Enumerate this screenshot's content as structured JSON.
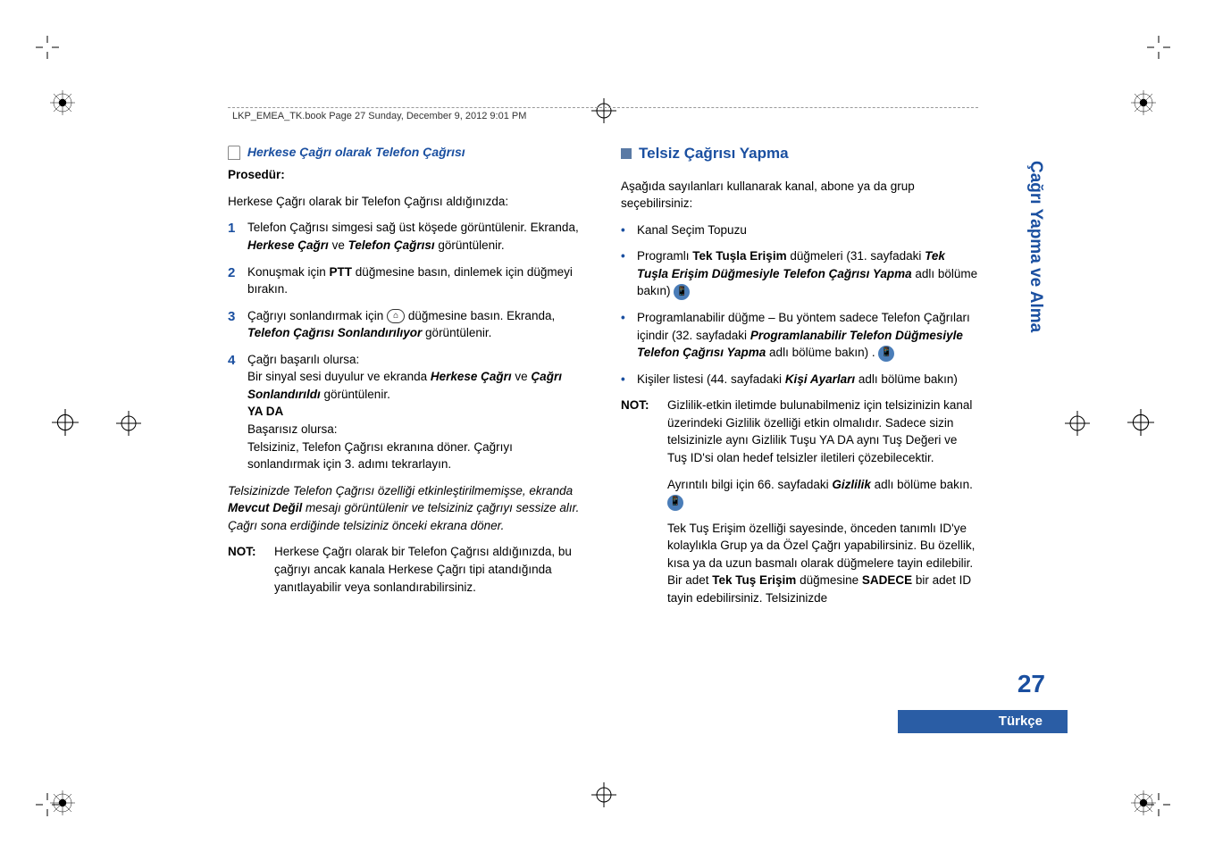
{
  "header": "LKP_EMEA_TK.book  Page 27  Sunday, December 9, 2012  9:01 PM",
  "left": {
    "title": "Herkese Çağrı olarak Telefon Çağrısı",
    "proc_label": "Prosedür:",
    "proc_intro": "Herkese Çağrı olarak bir Telefon Çağrısı aldığınızda:",
    "s1a": "Telefon Çağrısı simgesi sağ üst köşede görüntülenir. Ekranda, ",
    "s1b": "Herkese Çağrı",
    "s1c": " ve ",
    "s1d": "Telefon Çağrısı",
    "s1e": " görüntülenir.",
    "s2a": "Konuşmak için ",
    "s2b": "PTT",
    "s2c": " düğmesine basın, dinlemek için düğmeyi bırakın.",
    "s3a": "Çağrıyı sonlandırmak için ",
    "s3b": " düğmesine basın. Ekranda, ",
    "s3c": "Telefon Çağrısı Sonlandırılıyor",
    "s3d": " görüntülenir.",
    "s4a": "Çağrı başarılı olursa:",
    "s4b": "Bir sinyal sesi duyulur ve ekranda ",
    "s4c": "Herkese Çağrı",
    "s4d": " ve ",
    "s4e": "Çağrı Sonlandırıldı",
    "s4f": " görüntülenir.",
    "s4g": "YA DA",
    "s4h": "Başarısız olursa:",
    "s4i": "Telsiziniz, Telefon Çağrısı ekranına döner. Çağrıyı sonlandırmak için 3. adımı tekrarlayın.",
    "ital1": "Telsizinizde Telefon Çağrısı özelliği etkinleştirilmemişse, ekranda ",
    "ital2": "Mevcut Değil",
    "ital3": " mesajı görüntülenir ve telsiziniz çağrıyı sessize alır. Çağrı sona erdiğinde telsiziniz önceki ekrana döner.",
    "note_label": "NOT:",
    "note_text": "Herkese Çağrı olarak bir Telefon Çağrısı aldığınızda, bu çağrıyı ancak kanala Herkese Çağrı tipi atandığında yanıtlayabilir veya sonlandırabilirsiniz."
  },
  "right": {
    "heading": "Telsiz Çağrısı Yapma",
    "intro": "Aşağıda sayılanları kullanarak kanal, abone ya da grup seçebilirsiniz:",
    "b1": "Kanal Seçim Topuzu",
    "b2a": "Programlı ",
    "b2b": "Tek Tuşla Erişim",
    "b2c": " düğmeleri  (31. sayfadaki ",
    "b2d": "Tek Tuşla Erişim Düğmesiyle Telefon Çağrısı Yapma",
    "b2e": " adlı bölüme bakın) ",
    "b3a": "Programlanabilir düğme – Bu yöntem sadece Telefon Çağrıları içindir (32. sayfadaki ",
    "b3b": "Programlanabilir Telefon Düğmesiyle Telefon Çağrısı Yapma",
    "b3c": " adlı bölüme bakın) . ",
    "b4a": "Kişiler listesi (44. sayfadaki ",
    "b4b": "Kişi Ayarları",
    "b4c": " adlı bölüme bakın)",
    "note_label": "NOT:",
    "n1": "Gizlilik-etkin iletimde bulunabilmeniz için telsizinizin kanal üzerindeki Gizlilik özelliği etkin olmalıdır. Sadece sizin telsizinizle aynı Gizlilik Tuşu YA DA aynı Tuş Değeri ve Tuş ID'si olan hedef telsizler iletileri çözebilecektir.",
    "n2a": "Ayrıntılı bilgi için 66. sayfadaki ",
    "n2b": "Gizlilik",
    "n2c": " adlı bölüme bakın. ",
    "n3a": "Tek Tuş Erişim özelliği sayesinde, önceden tanımlı ID'ye kolaylıkla Grup ya da Özel Çağrı yapabilirsiniz. Bu özellik, kısa ya da uzun basmalı olarak düğmelere tayin edilebilir. Bir adet ",
    "n3b": "Tek Tuş Erişim",
    "n3c": " düğmesine ",
    "n3d": "SADECE",
    "n3e": " bir adet ID tayin edebilirsiniz. Telsizinizde"
  },
  "side_tab": "Çağrı Yapma ve Alma",
  "page_num": "27",
  "lang": "Türkçe",
  "btn_glyph": "⁂"
}
